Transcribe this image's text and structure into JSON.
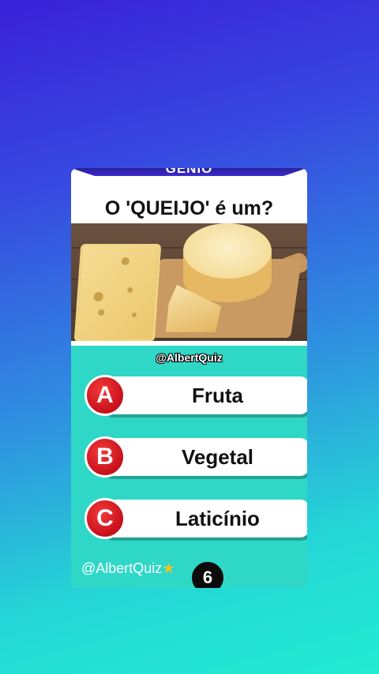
{
  "banner": {
    "text": "GÊNIO"
  },
  "question": {
    "text": "O 'QUEIJO' é um?"
  },
  "image": {
    "alt": "cheese"
  },
  "handle": {
    "text": "@AlbertQuiz"
  },
  "options": [
    {
      "letter": "A",
      "label": "Fruta"
    },
    {
      "letter": "B",
      "label": "Vegetal"
    },
    {
      "letter": "C",
      "label": "Laticínio"
    }
  ],
  "watermark": {
    "text": "@AlbertQuiz",
    "star": "★"
  },
  "timer": {
    "value": "6"
  },
  "colors": {
    "background_top": "#3a21d8",
    "background_bottom": "#22ecd2",
    "card": "#2fd8c6",
    "badge": "#d3121d"
  }
}
